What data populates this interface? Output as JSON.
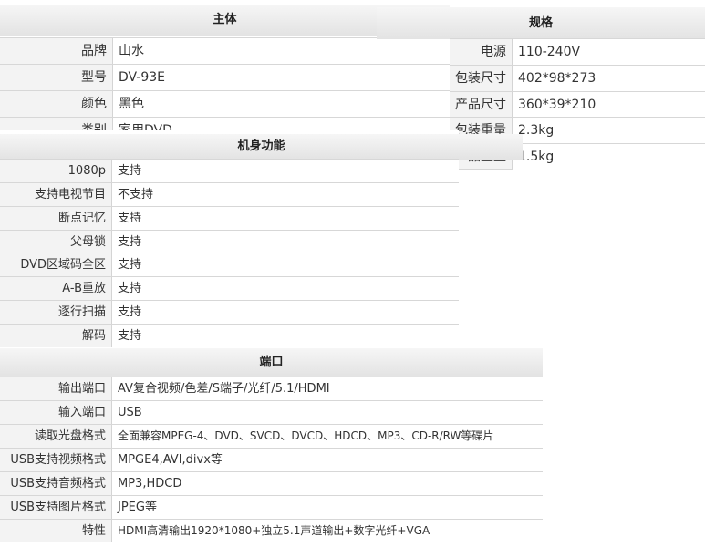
{
  "main": {
    "title": "主体",
    "rows": [
      {
        "label": "品牌",
        "value": "山水"
      },
      {
        "label": "型号",
        "value": "DV-93E"
      },
      {
        "label": "颜色",
        "value": "黑色"
      },
      {
        "label": "类别",
        "value": "家用DVD"
      }
    ]
  },
  "specs": {
    "title": "规格",
    "rows": [
      {
        "label": "电源",
        "value": "110-240V"
      },
      {
        "label": "包装尺寸",
        "value": "402*98*273"
      },
      {
        "label": "产品尺寸",
        "value": "360*39*210"
      },
      {
        "label": "包装重量",
        "value": "2.3kg"
      },
      {
        "label": "产品重量",
        "value": "1.5kg"
      }
    ]
  },
  "features": {
    "title": "机身功能",
    "rows": [
      {
        "label": "1080p",
        "value": "支持"
      },
      {
        "label": "支持电视节目",
        "value": "不支持"
      },
      {
        "label": "断点记忆",
        "value": "支持"
      },
      {
        "label": "父母锁",
        "value": "支持"
      },
      {
        "label": "DVD区域码全区",
        "value": "支持"
      },
      {
        "label": "A-B重放",
        "value": "支持"
      },
      {
        "label": "逐行扫描",
        "value": "支持"
      },
      {
        "label": "解码",
        "value": "支持"
      }
    ]
  },
  "ports": {
    "title": "端口",
    "rows": [
      {
        "label": "输出端口",
        "value": "AV复合视频/色差/S端子/光纤/5.1/HDMI"
      },
      {
        "label": "输入端口",
        "value": "USB"
      },
      {
        "label": "读取光盘格式",
        "value": "全面兼容MPEG-4、DVD、SVCD、DVCD、HDCD、MP3、CD-R/RW等碟片"
      },
      {
        "label": "USB支持视频格式",
        "value": "MPGE4,AVI,divx等"
      },
      {
        "label": "USB支持音频格式",
        "value": "MP3,HDCD"
      },
      {
        "label": "USB支持图片格式",
        "value": "JPEG等"
      },
      {
        "label": "特性",
        "value": "HDMI高清输出1920*1080+独立5.1声道输出+数字光纤+VGA"
      }
    ]
  }
}
